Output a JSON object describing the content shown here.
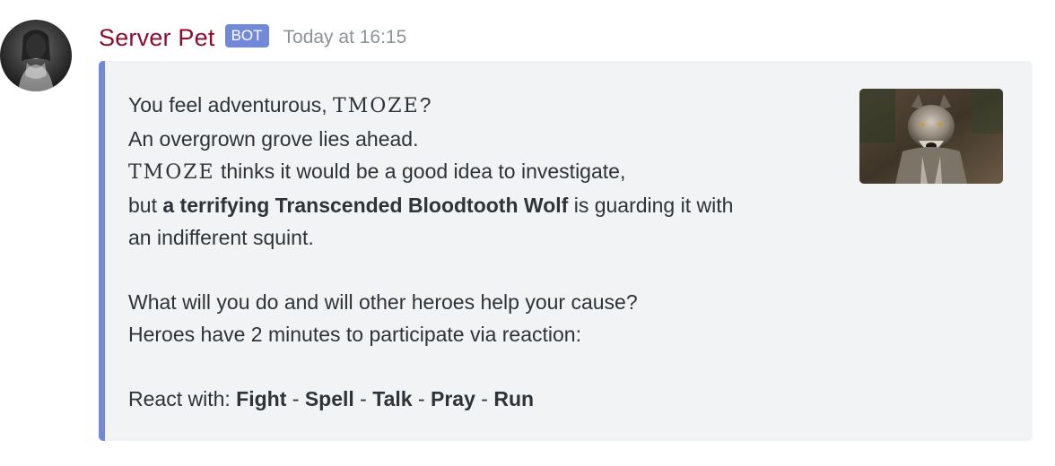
{
  "message": {
    "author": "Server Pet",
    "bot_tag": "BOT",
    "timestamp": "Today at 16:15",
    "avatar_icon": "user-avatar-icon"
  },
  "embed": {
    "accent_color": "#7289da",
    "thumbnail_icon": "wolf-image",
    "player_name": "TMOZE",
    "line1_prefix": "You feel adventurous,",
    "line1_suffix": "?",
    "line2": "An overgrown grove lies ahead.",
    "line3_suffix": "thinks it would be a good idea to investigate,",
    "line4_prefix": "but",
    "line4_bold": "a terrifying Transcended Bloodtooth Wolf",
    "line4_suffix": "is guarding it with",
    "line5": "an indifferent squint.",
    "line6": "What will you do and will other heroes help your cause?",
    "line7": "Heroes have 2 minutes to participate via reaction:",
    "react_prefix": "React with:",
    "separator": "-",
    "actions": [
      "Fight",
      "Spell",
      "Talk",
      "Pray",
      "Run"
    ]
  },
  "colors": {
    "username": "#8b0d2e",
    "bot_tag_bg": "#7289da",
    "timestamp": "#8e9297",
    "embed_bg": "#f2f3f5",
    "text": "#2e3338"
  }
}
